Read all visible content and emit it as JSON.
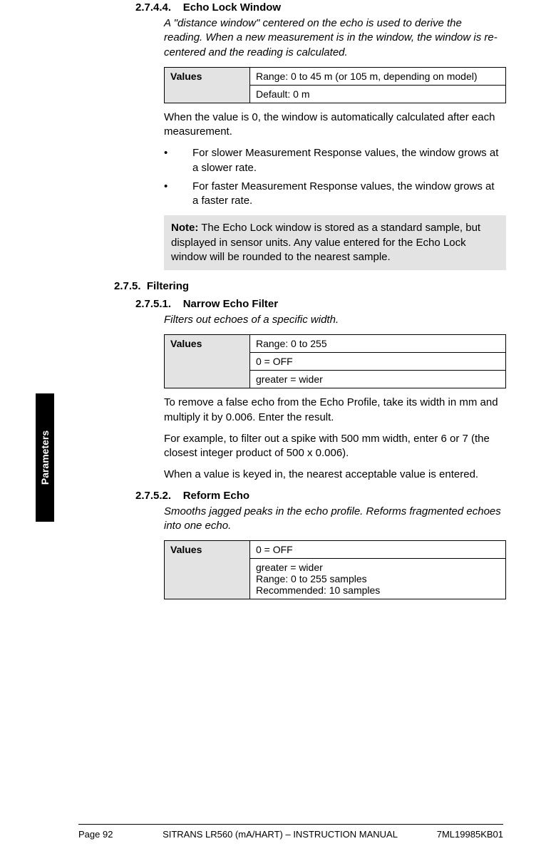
{
  "sideTab": "Parameters",
  "s1": {
    "num": "2.7.4.4.",
    "title": "Echo Lock Window",
    "desc": "A \"distance window\" centered on the echo is used to derive the reading. When a new measurement is in the window, the window is re-centered and the reading is calculated.",
    "valLabel": "Values",
    "range": "Range: 0 to 45 m (or 105 m, depending on model)",
    "default": "Default: 0 m",
    "para1": "When the value is 0, the window is automatically calculated after each measurement.",
    "b1": "For slower Measurement Response values, the window grows at a slower rate.",
    "b2": "For faster Measurement Response values, the window grows at a faster rate.",
    "noteLabel": "Note:",
    "noteText": " The Echo Lock window is stored as a standard sample, but displayed in sensor units. Any value entered for the Echo Lock window will be rounded to the nearest sample."
  },
  "s2": {
    "num": "2.7.5.",
    "title": "Filtering"
  },
  "s3": {
    "num": "2.7.5.1.",
    "title": "Narrow Echo Filter",
    "desc": "Filters out echoes of a specific width.",
    "valLabel": "Values",
    "r1": "Range: 0 to 255",
    "r2": "0 = OFF",
    "r3": "greater = wider",
    "p1": "To remove a false echo from the Echo Profile, take its width in mm and multiply it by 0.006. Enter the result.",
    "p2": "For example, to filter out a spike with 500 mm width, enter 6 or 7 (the closest integer product of 500 x 0.006).",
    "p3": "When a value is keyed in, the nearest acceptable value is entered."
  },
  "s4": {
    "num": "2.7.5.2.",
    "title": "Reform Echo",
    "desc": "Smooths jagged peaks in the echo profile. Reforms fragmented echoes into one echo.",
    "valLabel": "Values",
    "r1": "0 = OFF",
    "r2": "greater = wider\nRange: 0 to 255 samples\nRecommended: 10 samples"
  },
  "footer": {
    "page": "Page 92",
    "title": "SITRANS LR560 (mA/HART) – INSTRUCTION MANUAL",
    "code": "7ML19985KB01"
  }
}
